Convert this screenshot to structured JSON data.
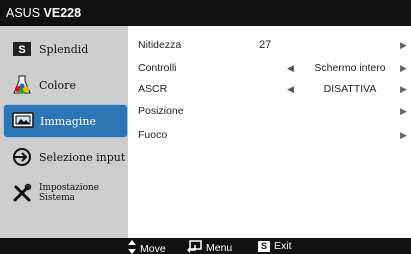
{
  "title": {
    "brand": "ASUS",
    "model": "VE228"
  },
  "sidebar": {
    "items": [
      {
        "label": "Splendid",
        "icon": "s-box-icon"
      },
      {
        "label": "Colore",
        "icon": "color-flask-icon"
      },
      {
        "label": "Immagine",
        "icon": "picture-monitor-icon"
      },
      {
        "label": "Selezione input",
        "icon": "input-arrow-icon"
      },
      {
        "label": "Impostazione Sistema",
        "icon": "tools-icon"
      }
    ],
    "active_index": 2
  },
  "settings": {
    "rows": [
      {
        "label": "Nitidezza",
        "value": "27"
      },
      {
        "label": "Controlli",
        "value": "Schermo intero"
      },
      {
        "label": "ASCR",
        "value": "DISATTIVA"
      },
      {
        "label": "Posizione"
      },
      {
        "label": "Fuoco"
      }
    ]
  },
  "footer": {
    "move_label": "Move",
    "menu_label": "Menu",
    "exit_label": "Exit",
    "exit_key": "S"
  },
  "colors": {
    "title_bar": "#111111",
    "sidebar_bg": "#cdcdcd",
    "active_item": "#2e75b6",
    "content_bg": "#ffffff"
  }
}
